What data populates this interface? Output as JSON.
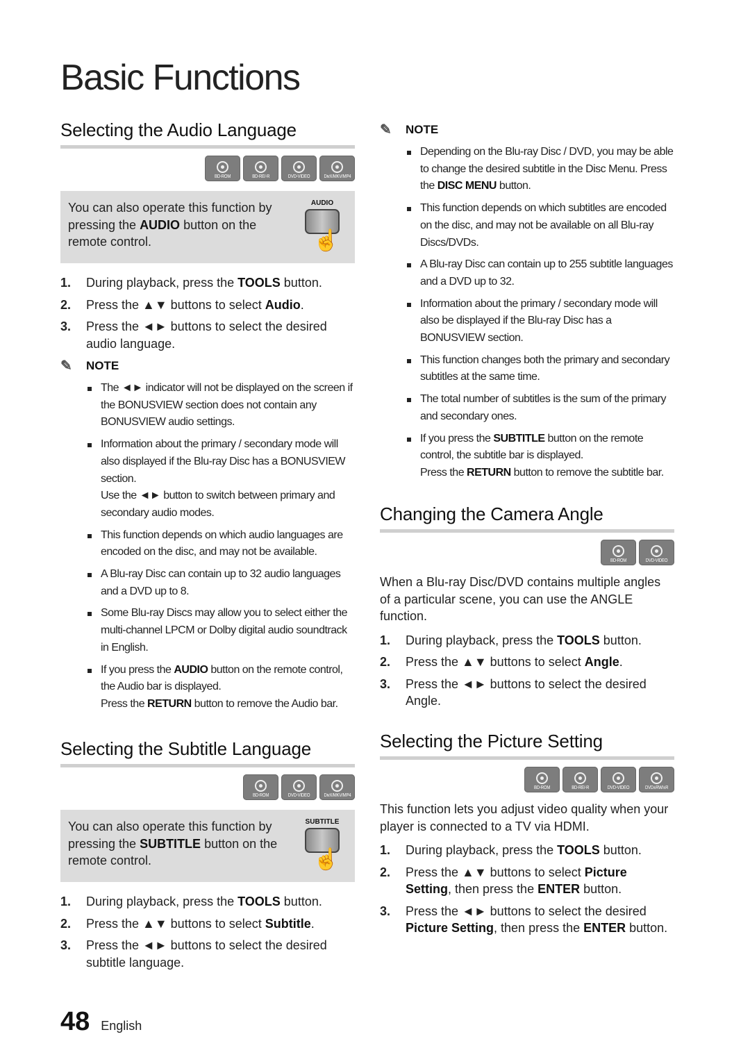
{
  "page": {
    "title": "Basic Functions",
    "page_number": "48",
    "language": "English"
  },
  "audio": {
    "heading": "Selecting the Audio Language",
    "badges": [
      {
        "label": "BD-ROM",
        "icon": "disc-icon"
      },
      {
        "label": "BD-RE/-R",
        "icon": "disc-icon"
      },
      {
        "label": "DVD-VIDEO",
        "icon": "disc-icon"
      },
      {
        "label": "DivX/MKV/MP4",
        "icon": "film-reel-icon"
      }
    ],
    "tip": {
      "pre": "You can also operate this function by pressing the ",
      "bold": "AUDIO",
      "post": " button on the remote control.",
      "remote_label": "AUDIO"
    },
    "steps": [
      {
        "num": "1.",
        "pre": "During playback, press the ",
        "bold": "TOOLS",
        "post": " button."
      },
      {
        "num": "2.",
        "pre": "Press the ▲▼ buttons to select ",
        "bold": "Audio",
        "post": "."
      },
      {
        "num": "3.",
        "pre": "Press the ◄► buttons to select the desired audio language.",
        "bold": "",
        "post": ""
      }
    ],
    "note_label": "NOTE",
    "notes": [
      {
        "pre": "The ◄► indicator will not be displayed on the screen if the BONUSVIEW section does not contain any BONUSVIEW audio settings.",
        "bold": "",
        "post": "",
        "extra": ""
      },
      {
        "pre": "Information about the primary / secondary mode will also displayed if the Blu-ray Disc has a BONUSVIEW section.",
        "bold": "",
        "post": "",
        "extra": "Use the ◄► button to switch between primary and secondary audio modes."
      },
      {
        "pre": "This function depends on which audio languages are encoded on the disc, and may not be available.",
        "bold": "",
        "post": "",
        "extra": ""
      },
      {
        "pre": "A Blu-ray Disc can contain up to 32 audio languages and a DVD up to 8.",
        "bold": "",
        "post": "",
        "extra": ""
      },
      {
        "pre": "Some Blu-ray Discs may allow you to select either the multi-channel LPCM or Dolby digital audio soundtrack in English.",
        "bold": "",
        "post": "",
        "extra": ""
      },
      {
        "pre": "If you press the ",
        "bold": "AUDIO",
        "post": " button on the remote control, the Audio bar is displayed.",
        "extra_pre": "Press the ",
        "extra_bold": "RETURN",
        "extra_post": " button to remove the Audio bar."
      }
    ]
  },
  "subtitle": {
    "heading": "Selecting the Subtitle Language",
    "badges": [
      {
        "label": "BD-ROM",
        "icon": "disc-icon"
      },
      {
        "label": "DVD-VIDEO",
        "icon": "disc-icon"
      },
      {
        "label": "DivX/MKV/MP4",
        "icon": "film-reel-icon"
      }
    ],
    "tip": {
      "pre": "You can also operate this function by pressing the ",
      "bold": "SUBTITLE",
      "post": " button on the remote control.",
      "remote_label": "SUBTITLE"
    },
    "steps": [
      {
        "num": "1.",
        "pre": "During playback, press the ",
        "bold": "TOOLS",
        "post": " button."
      },
      {
        "num": "2.",
        "pre": "Press the ▲▼ buttons to select ",
        "bold": "Subtitle",
        "post": "."
      },
      {
        "num": "3.",
        "pre": "Press the ◄► buttons to select the desired subtitle language.",
        "bold": "",
        "post": ""
      }
    ],
    "note_label": "NOTE",
    "notes": [
      {
        "pre": "Depending on the Blu-ray Disc / DVD, you may be able to change the desired subtitle in the Disc Menu. Press the ",
        "bold": "DISC MENU",
        "post": " button."
      },
      {
        "pre": "This function depends on which subtitles are encoded on the disc, and may not be available on all Blu-ray Discs/DVDs.",
        "bold": "",
        "post": ""
      },
      {
        "pre": "A Blu-ray Disc can contain up to 255 subtitle languages and a DVD up to 32.",
        "bold": "",
        "post": ""
      },
      {
        "pre": "Information about the primary / secondary mode will also be displayed if the Blu-ray Disc has a BONUSVIEW section.",
        "bold": "",
        "post": ""
      },
      {
        "pre": "This function changes both the primary and secondary subtitles at the same time.",
        "bold": "",
        "post": ""
      },
      {
        "pre": "The total number of subtitles is the sum of the primary and secondary ones.",
        "bold": "",
        "post": ""
      },
      {
        "pre": "If you press the ",
        "bold": "SUBTITLE",
        "post": " button on the remote control, the subtitle bar is displayed.",
        "extra_pre": "Press the ",
        "extra_bold": "RETURN",
        "extra_post": " button to remove the subtitle bar."
      }
    ]
  },
  "angle": {
    "heading": "Changing the Camera Angle",
    "badges": [
      {
        "label": "BD-ROM",
        "icon": "disc-icon"
      },
      {
        "label": "DVD-VIDEO",
        "icon": "disc-icon"
      }
    ],
    "intro": "When a Blu-ray Disc/DVD contains multiple angles of a particular scene, you can use the ANGLE function.",
    "steps": [
      {
        "num": "1.",
        "pre": "During playback, press the ",
        "bold": "TOOLS",
        "post": " button."
      },
      {
        "num": "2.",
        "pre": "Press the ▲▼ buttons to select ",
        "bold": "Angle",
        "post": "."
      },
      {
        "num": "3.",
        "pre": "Press the ◄► buttons to select the desired Angle.",
        "bold": "",
        "post": ""
      }
    ]
  },
  "picture": {
    "heading": "Selecting the Picture Setting",
    "badges": [
      {
        "label": "BD-ROM",
        "icon": "disc-icon"
      },
      {
        "label": "BD-RE/-R",
        "icon": "disc-icon"
      },
      {
        "label": "DVD-VIDEO",
        "icon": "disc-icon"
      },
      {
        "label": "DVD±RW/±R",
        "icon": "disc-icon"
      }
    ],
    "intro": "This function lets you adjust video quality when your player is connected to a TV via HDMI.",
    "steps": [
      {
        "num": "1.",
        "pre": "During playback, press the ",
        "bold": "TOOLS",
        "post": " button."
      },
      {
        "num": "2.",
        "pre": "Press the ▲▼ buttons to select ",
        "bold": "Picture Setting",
        "post": ", then press the ",
        "bold2": "ENTER",
        "post2": " button."
      },
      {
        "num": "3.",
        "pre": "Press the ◄► buttons to select the desired ",
        "bold": "Picture Setting",
        "post": ", then press the ",
        "bold2": "ENTER",
        "post2": " button."
      }
    ]
  }
}
